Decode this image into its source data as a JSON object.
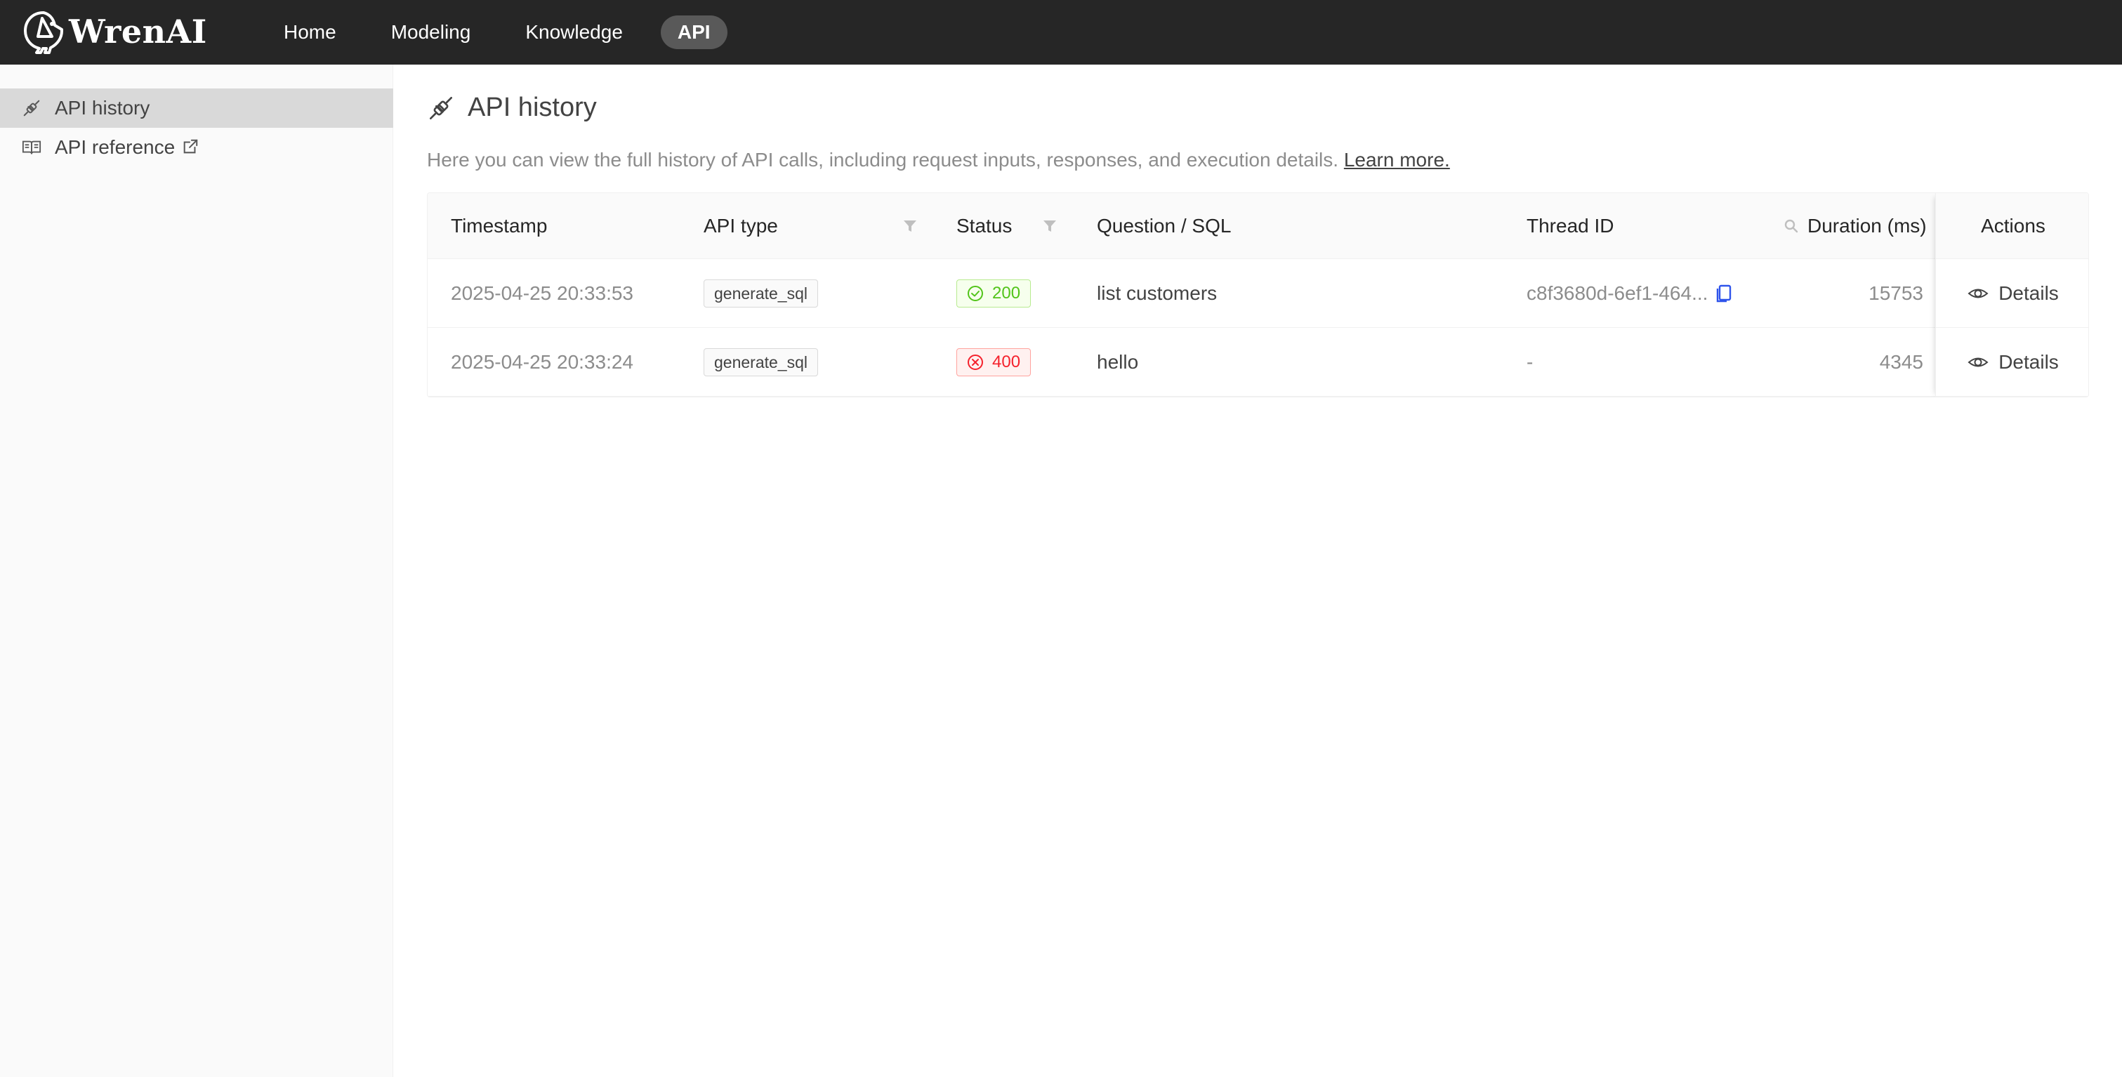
{
  "app": {
    "name": "WrenAI"
  },
  "nav": {
    "items": [
      {
        "label": "Home"
      },
      {
        "label": "Modeling"
      },
      {
        "label": "Knowledge"
      },
      {
        "label": "API",
        "active": true
      }
    ]
  },
  "sidebar": {
    "items": [
      {
        "label": "API history",
        "icon": "api-plug-icon",
        "active": true
      },
      {
        "label": "API reference",
        "icon": "book-icon",
        "external": true
      }
    ]
  },
  "page": {
    "title": "API history",
    "description": "Here you can view the full history of API calls, including request inputs, responses, and execution details.",
    "learn_more": "Learn more."
  },
  "table": {
    "headers": {
      "timestamp": "Timestamp",
      "api_type": "API type",
      "status": "Status",
      "question": "Question / SQL",
      "thread_id": "Thread ID",
      "duration": "Duration (ms)",
      "actions": "Actions"
    },
    "rows": [
      {
        "timestamp": "2025-04-25 20:33:53",
        "api_type": "generate_sql",
        "status": "200",
        "status_kind": "success",
        "question": "list customers",
        "thread_id": "c8f3680d-6ef1-464...",
        "duration": "15753",
        "action": "Details"
      },
      {
        "timestamp": "2025-04-25 20:33:24",
        "api_type": "generate_sql",
        "status": "400",
        "status_kind": "error",
        "question": "hello",
        "thread_id": "-",
        "duration": "4345",
        "action": "Details"
      }
    ]
  },
  "colors": {
    "topbar": "#262626",
    "success": "#52c41a",
    "error": "#f5222d",
    "copy_icon": "#2f54eb"
  }
}
